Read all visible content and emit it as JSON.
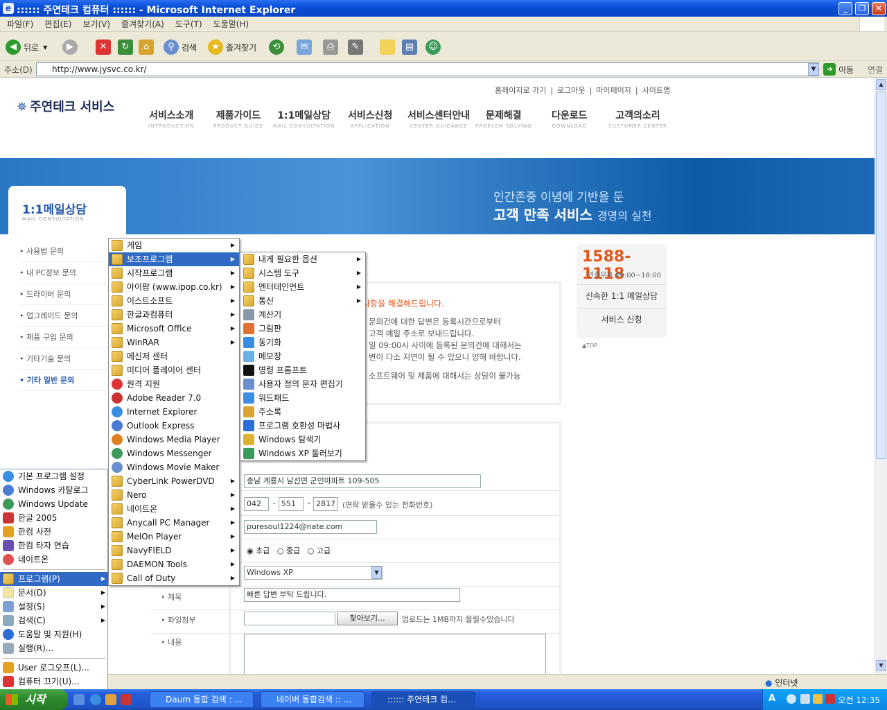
{
  "window": {
    "title": ":::::: 주연테크 컴퓨터 :::::: - Microsoft Internet Explorer",
    "min_label": "_",
    "max_label": "❐",
    "close_label": "✕"
  },
  "menubar": [
    "파일(F)",
    "편집(E)",
    "보기(V)",
    "즐겨찾기(A)",
    "도구(T)",
    "도움말(H)"
  ],
  "toolbar": {
    "back": "뒤로",
    "search": "검색",
    "favorites": "즐겨찾기"
  },
  "address": {
    "label": "주소(D)",
    "url": "http://www.jysvc.co.kr/",
    "go": "이동",
    "links": "연결"
  },
  "site": {
    "top_links": [
      "홈페이지로 가기",
      "로그아웃",
      "마이페이지",
      "사이트맵"
    ],
    "logo": "주연테크 서비스",
    "nav": [
      {
        "k": "서비스소개",
        "e": "INTRODUCTION"
      },
      {
        "k": "제품가이드",
        "e": "PRODUCT GUIDE"
      },
      {
        "k": "1:1메일상담",
        "e": "MAIL CONSULTATION"
      },
      {
        "k": "서비스신청",
        "e": "APPLICATION"
      },
      {
        "k": "서비스센터안내",
        "e": "CENTER GUIDANCE"
      },
      {
        "k": "문제해결",
        "e": "PROBLEM SOLVING"
      },
      {
        "k": "다운로드",
        "e": "DOWNLOAD"
      },
      {
        "k": "고객의소리",
        "e": "CUSTOMER CENTER"
      }
    ],
    "banner_line1": "인간존중 이념에 기반을 둔",
    "banner_line2": "고객 만족 서비스",
    "banner_line2b": "경영의 실천",
    "side_title": "1:1메일상담",
    "side_sub": "MAIL CONSULTATION",
    "side_items": [
      "• 사용법 문의",
      "• 내 PC정보 문의",
      "• 드라이버 문의",
      "• 업그레이드 문의",
      "• 제품 구입 문의",
      "• 기타기술 문의",
      "• 기타 일반 문의"
    ],
    "phone": "1588-1118",
    "hours": "연중무휴 09:00~18:00",
    "quick1": "신속한 1:1 메일상담",
    "quick2": "서비스 신청",
    "top": "▲TOP",
    "info_head": "사항을 해결해드립니다.",
    "info_lines": [
      "문의건에 대한 답변은 등록시간으로부터",
      "고객 메일 주소로 보내드립니다.",
      "일 09:00시 사이에 등록된 문의건에 대해서는",
      "변이 다소 지연이 될 수 있으니 양해 바랍니다.",
      "소프트웨어 및 제품에 대해서는 상담이 불가능"
    ],
    "form": {
      "address": "충남 계룡시 남선면 군인아파트 109-505",
      "phone1": "042",
      "phone2": "551",
      "phone3": "2817",
      "phone_note": "(연락 받을수 있는 전화번호)",
      "email": "puresoul1224@nate.com",
      "level_options": [
        "초급",
        "중급",
        "고급"
      ],
      "os": "Windows XP",
      "subject_label": "• 제목",
      "subject": "빠른 답변 부탁 드립니다.",
      "attach_label": "• 파일첨부",
      "browse": "찾아보기...",
      "upload_note": "업로드는 1MB까지 올릴수있습니다",
      "content_label": "• 내용"
    }
  },
  "start_menu": {
    "pinned": [
      "기본 프로그램 설정",
      "Windows 카탈로그",
      "Windows Update",
      "한글 2005",
      "한컴 사전",
      "한컴 타자 연습",
      "네이트온"
    ],
    "items": [
      "프로그램(P)",
      "문서(D)",
      "설정(S)",
      "검색(C)",
      "도움말 및 지원(H)",
      "실행(R)..."
    ],
    "logoff": "User 로그오프(L)...",
    "shutdown": "컴퓨터 끄기(U)..."
  },
  "programs_menu": [
    "게임",
    "보조프로그램",
    "시작프로그램",
    "아이팝 (www.ipop.co.kr)",
    "이스트소프트",
    "한글과컴퓨터",
    "Microsoft Office",
    "WinRAR",
    "메신저 센터",
    "미디어 플레이어 센터",
    "원격 지원",
    "Adobe Reader 7.0",
    "Internet Explorer",
    "Outlook Express",
    "Windows Media Player",
    "Windows Messenger",
    "Windows Movie Maker",
    "CyberLink PowerDVD",
    "Nero",
    "네이트온",
    "Anycall PC Manager",
    "MelOn Player",
    "NavyFIELD",
    "DAEMON Tools",
    "Call of Duty"
  ],
  "accessories_menu": [
    "내게 필요한 옵션",
    "시스템 도구",
    "엔터테인먼트",
    "통신",
    "계산기",
    "그림판",
    "동기화",
    "메모장",
    "명령 프롬프트",
    "사용자 정의 문자 편집기",
    "워드패드",
    "주소록",
    "프로그램 호환성 마법사",
    "Windows 탐색기",
    "Windows XP 둘러보기"
  ],
  "status": {
    "zone": "인터넷"
  },
  "taskbar": {
    "start": "시작",
    "tasks": [
      "Daum 통합 검색 : ...",
      "네이버 통합검색 :: ...",
      ":::::: 주연테크 컴..."
    ],
    "clock": "오전 12:35"
  },
  "colors": {
    "accent": "#316ac5",
    "brand": "#2258a8",
    "phone": "#e0581c"
  }
}
